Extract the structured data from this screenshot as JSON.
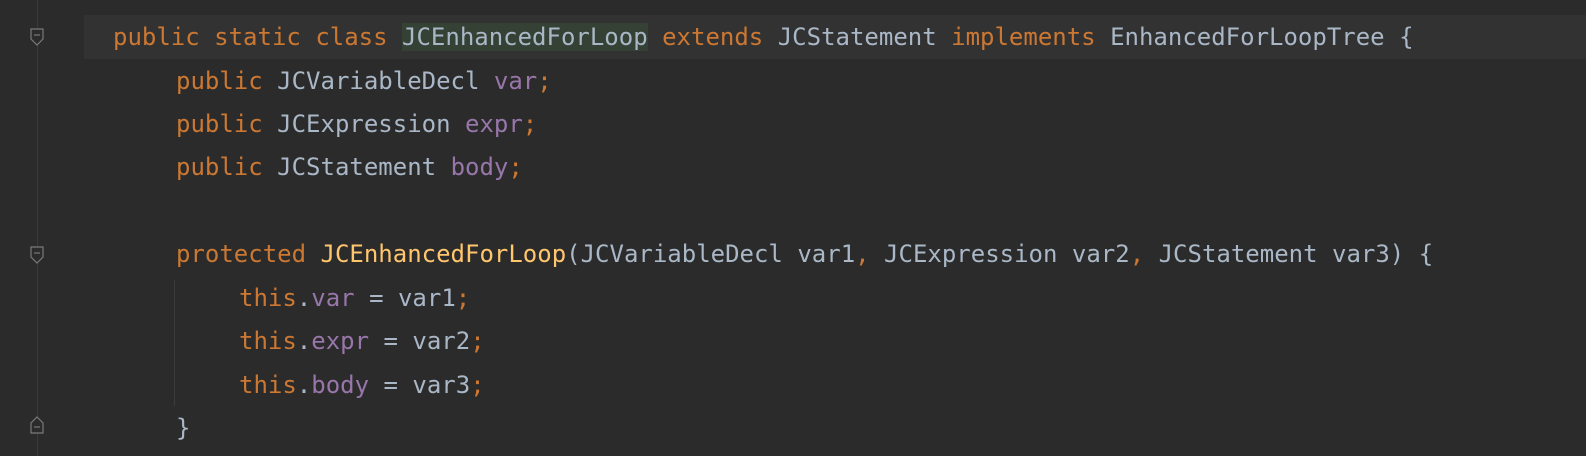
{
  "editor": {
    "colors": {
      "background": "#2b2b2b",
      "keyword": "#cc7832",
      "identifier": "#a9b7c6",
      "field": "#9876aa",
      "method": "#ffc66d",
      "highlight": "#344134"
    },
    "lines": [
      {
        "kw_public": "public",
        "kw_static": "static",
        "kw_class": "class",
        "class_name": "JCEnhancedForLoop",
        "kw_extends": "extends",
        "parent": "JCStatement",
        "kw_implements": "implements",
        "iface": "EnhancedForLoopTree",
        "brace": "{"
      },
      {
        "kw": "public",
        "type": "JCVariableDecl",
        "name": "var",
        "semi": ";"
      },
      {
        "kw": "public",
        "type": "JCExpression",
        "name": "expr",
        "semi": ";"
      },
      {
        "kw": "public",
        "type": "JCStatement",
        "name": "body",
        "semi": ";"
      },
      {
        "kw": "protected",
        "method": "JCEnhancedForLoop",
        "paren_open": "(",
        "t1": "JCVariableDecl",
        "p1": "var1",
        "c1": ",",
        "t2": "JCExpression",
        "p2": "var2",
        "c2": ",",
        "t3": "JCStatement",
        "p3": "var3",
        "paren_close": ")",
        "brace": "{"
      },
      {
        "this": "this",
        "dot": ".",
        "field": "var",
        "eq": "=",
        "val": "var1",
        "semi": ";"
      },
      {
        "this": "this",
        "dot": ".",
        "field": "expr",
        "eq": "=",
        "val": "var2",
        "semi": ";"
      },
      {
        "this": "this",
        "dot": ".",
        "field": "body",
        "eq": "=",
        "val": "var3",
        "semi": ";"
      },
      {
        "brace": "}"
      }
    ]
  }
}
